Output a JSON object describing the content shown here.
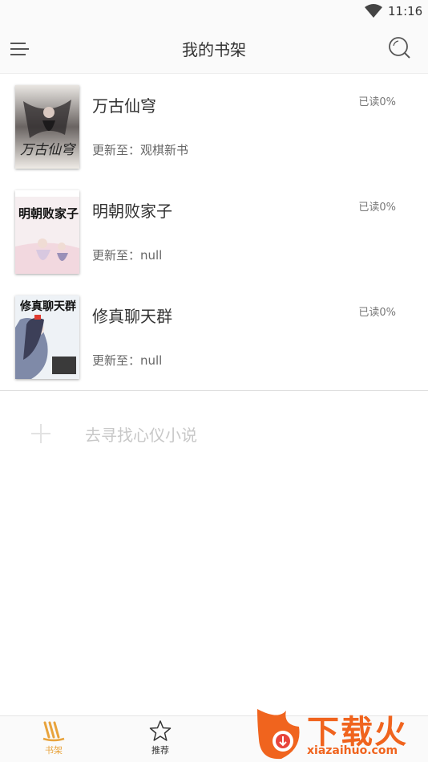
{
  "status_bar": {
    "time": "11:16"
  },
  "app_bar": {
    "title": "我的书架"
  },
  "books": [
    {
      "title": "万古仙穹",
      "progress": "已读0%",
      "update": "更新至：观棋新书",
      "cover_text": "万古仙穹"
    },
    {
      "title": "明朝败家子",
      "progress": "已读0%",
      "update": "更新至：null",
      "cover_text": "明朝败家子"
    },
    {
      "title": "修真聊天群",
      "progress": "已读0%",
      "update": "更新至：null",
      "cover_text": "修真聊天群"
    }
  ],
  "add_book": {
    "label": "去寻找心仪小说"
  },
  "bottom_nav": {
    "shelf_label": "书架",
    "recommend_label": "推荐"
  },
  "watermark": {
    "text": "下载火",
    "url": "xiazaihuo.com"
  },
  "colors": {
    "accent": "#e8a33c",
    "watermark": "#f0641e"
  }
}
